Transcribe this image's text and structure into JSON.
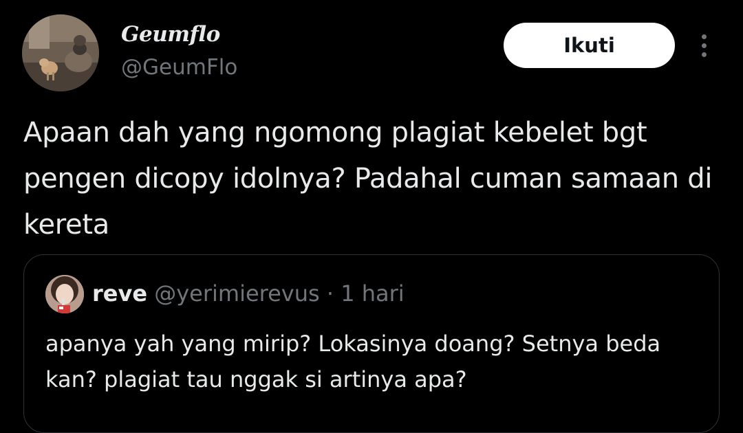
{
  "tweet": {
    "author": {
      "display_name": "Geumflo",
      "handle": "@GeumFlo",
      "avatar_icon": "profile-photo-cats-icon"
    },
    "follow_button_label": "Ikuti",
    "more_icon": "more-vertical-icon",
    "text": "Apaan dah yang ngomong plagiat kebelet bgt pengen dicopy idolnya? Padahal cuman samaan di kereta"
  },
  "quoted_tweet": {
    "author": {
      "display_name": "reve",
      "handle": "@yerimierevus",
      "avatar_icon": "profile-photo-girl-icon"
    },
    "separator": "·",
    "time": "1 hari",
    "text": "apanya yah yang mirip? Lokasinya doang? Setnya beda kan? plagiat tau nggak si artinya apa?"
  },
  "colors": {
    "background": "#000000",
    "text_primary": "#e7e9ea",
    "text_secondary": "#71767b",
    "border": "#2f3336",
    "button_bg": "#ffffff"
  }
}
